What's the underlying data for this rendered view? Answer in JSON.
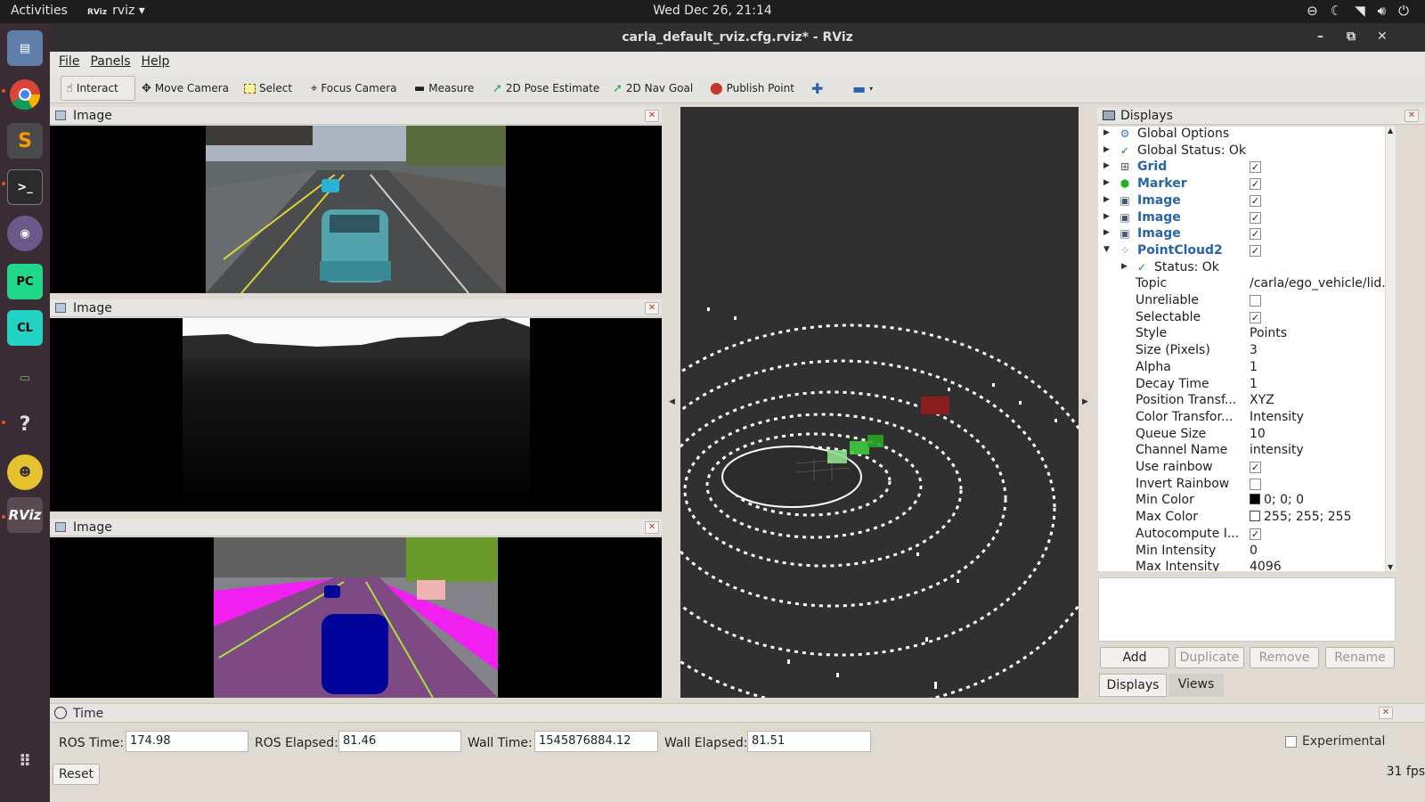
{
  "topbar": {
    "activities": "Activities",
    "app_name": "rviz",
    "app_logo": "RViz",
    "clock": "Wed Dec 26, 21:14",
    "tray_icons": [
      "accessibility-icon",
      "night-light-icon",
      "wifi-icon",
      "volume-icon",
      "power-icon"
    ]
  },
  "dock": {
    "items": [
      "files-icon",
      "chrome-icon",
      "sublime-icon",
      "terminal-icon",
      "github-icon",
      "pycharm-icon",
      "clion-icon",
      "battery-icon",
      "help-icon",
      "gazebo-icon",
      "rviz-icon"
    ],
    "rviz_label": "RViz",
    "pycharm_label": "PC",
    "clion_label": "CL",
    "sublime_label": "S"
  },
  "window": {
    "title": "carla_default_rviz.cfg.rviz* - RViz"
  },
  "menubar": {
    "file": "File",
    "panels": "Panels",
    "help": "Help"
  },
  "toolbar": {
    "interact": "Interact",
    "move_camera": "Move Camera",
    "select": "Select",
    "focus_camera": "Focus Camera",
    "measure": "Measure",
    "pose_estimate": "2D Pose Estimate",
    "nav_goal": "2D Nav Goal",
    "publish_point": "Publish Point"
  },
  "image_panels": [
    {
      "title": "Image"
    },
    {
      "title": "Image"
    },
    {
      "title": "Image"
    }
  ],
  "displays": {
    "title": "Displays",
    "rows": [
      {
        "label": "Global Options"
      },
      {
        "label": "Global Status: Ok"
      },
      {
        "label": "Grid"
      },
      {
        "label": "Marker"
      },
      {
        "label": "Image"
      },
      {
        "label": "Image"
      },
      {
        "label": "Image"
      },
      {
        "label": "PointCloud2"
      },
      {
        "label": "Status: Ok"
      }
    ],
    "props": [
      {
        "label": "Topic",
        "value": "/carla/ego_vehicle/lid."
      },
      {
        "label": "Unreliable",
        "value": ""
      },
      {
        "label": "Selectable",
        "value": ""
      },
      {
        "label": "Style",
        "value": "Points"
      },
      {
        "label": "Size (Pixels)",
        "value": "3"
      },
      {
        "label": "Alpha",
        "value": "1"
      },
      {
        "label": "Decay Time",
        "value": "1"
      },
      {
        "label": "Position Transf...",
        "value": "XYZ"
      },
      {
        "label": "Color Transfor...",
        "value": "Intensity"
      },
      {
        "label": "Queue Size",
        "value": "10"
      },
      {
        "label": "Channel Name",
        "value": "intensity"
      },
      {
        "label": "Use rainbow",
        "value": ""
      },
      {
        "label": "Invert Rainbow",
        "value": ""
      },
      {
        "label": "Min Color",
        "value": "0; 0; 0"
      },
      {
        "label": "Max Color",
        "value": "255; 255; 255"
      },
      {
        "label": "Autocompute I...",
        "value": ""
      },
      {
        "label": "Min Intensity",
        "value": "0"
      },
      {
        "label": "Max Intensity",
        "value": "4096"
      }
    ],
    "checked": {
      "grid": true,
      "marker": true,
      "image1": true,
      "image2": true,
      "image3": true,
      "pointcloud": true,
      "unreliable": false,
      "selectable": true,
      "use_rainbow": true,
      "invert_rainbow": false,
      "autocompute": true
    },
    "buttons": {
      "add": "Add",
      "duplicate": "Duplicate",
      "remove": "Remove",
      "rename": "Rename"
    },
    "tabs": {
      "displays": "Displays",
      "views": "Views"
    }
  },
  "time": {
    "title": "Time",
    "ros_time_label": "ROS Time:",
    "ros_time": "174.98",
    "ros_elapsed_label": "ROS Elapsed:",
    "ros_elapsed": "81.46",
    "wall_time_label": "Wall Time:",
    "wall_time": "1545876884.12",
    "wall_elapsed_label": "Wall Elapsed:",
    "wall_elapsed": "81.51",
    "experimental": "Experimental",
    "reset": "Reset",
    "fps": "31 fps"
  },
  "colors": {
    "dock_bg": "#3a2c34",
    "viewport_bg": "#303030",
    "link_blue": "#2864a8"
  }
}
